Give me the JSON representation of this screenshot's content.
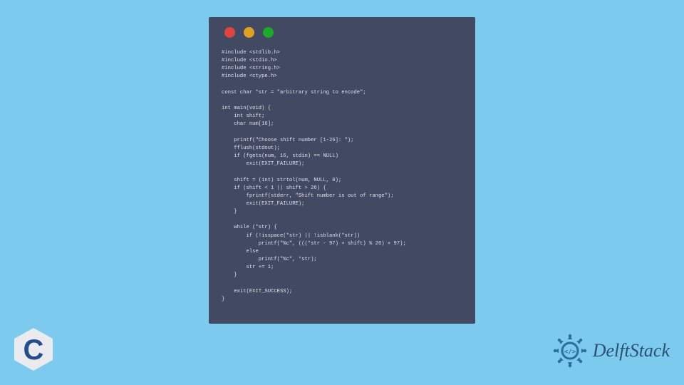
{
  "code_lines": [
    "#include <stdlib.h>",
    "#include <stdio.h>",
    "#include <string.h>",
    "#include <ctype.h>",
    "",
    "const char *str = \"arbitrary string to encode\";",
    "",
    "int main(void) {",
    "    int shift;",
    "    char num[16];",
    "",
    "    printf(\"Choose shift number [1-26]: \");",
    "    fflush(stdout);",
    "    if (fgets(num, 16, stdin) == NULL)",
    "        exit(EXIT_FAILURE);",
    "",
    "    shift = (int) strtol(num, NULL, 0);",
    "    if (shift < 1 || shift > 26) {",
    "        fprintf(stderr, \"Shift number is out of range\");",
    "        exit(EXIT_FAILURE);",
    "    }",
    "",
    "    while (*str) {",
    "        if (!isspace(*str) || !isblank(*str))",
    "            printf(\"%c\", (((*str - 97) + shift) % 26) + 97);",
    "        else",
    "            printf(\"%c\", *str);",
    "        str += 1;",
    "    }",
    "",
    "    exit(EXIT_SUCCESS);",
    "}"
  ],
  "brand": {
    "name": "DelftStack"
  },
  "logo": {
    "letter": "C"
  },
  "colors": {
    "background": "#7ccaed",
    "window": "#424a63",
    "code_text": "#dfe0e6",
    "c_bg": "#e9ebee",
    "c_letter": "#244e8a",
    "delft_text": "#2c5071",
    "badge": "#2d6d9e"
  }
}
